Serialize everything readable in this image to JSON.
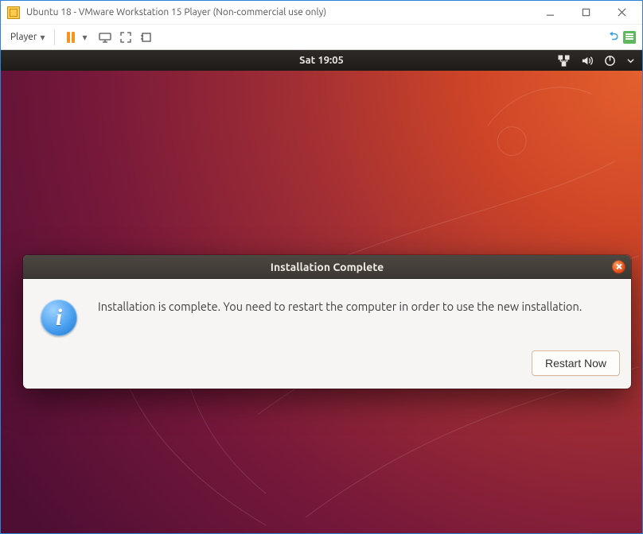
{
  "vmware": {
    "title": "Ubuntu 18 - VMware Workstation 15 Player (Non-commercial use only)",
    "player_menu_label": "Player"
  },
  "ubuntu_panel": {
    "clock": "Sat 19:05"
  },
  "dialog": {
    "title": "Installation Complete",
    "message": "Installation is complete. You need to restart the computer in order to use the new installation.",
    "restart_button_label": "Restart Now"
  }
}
